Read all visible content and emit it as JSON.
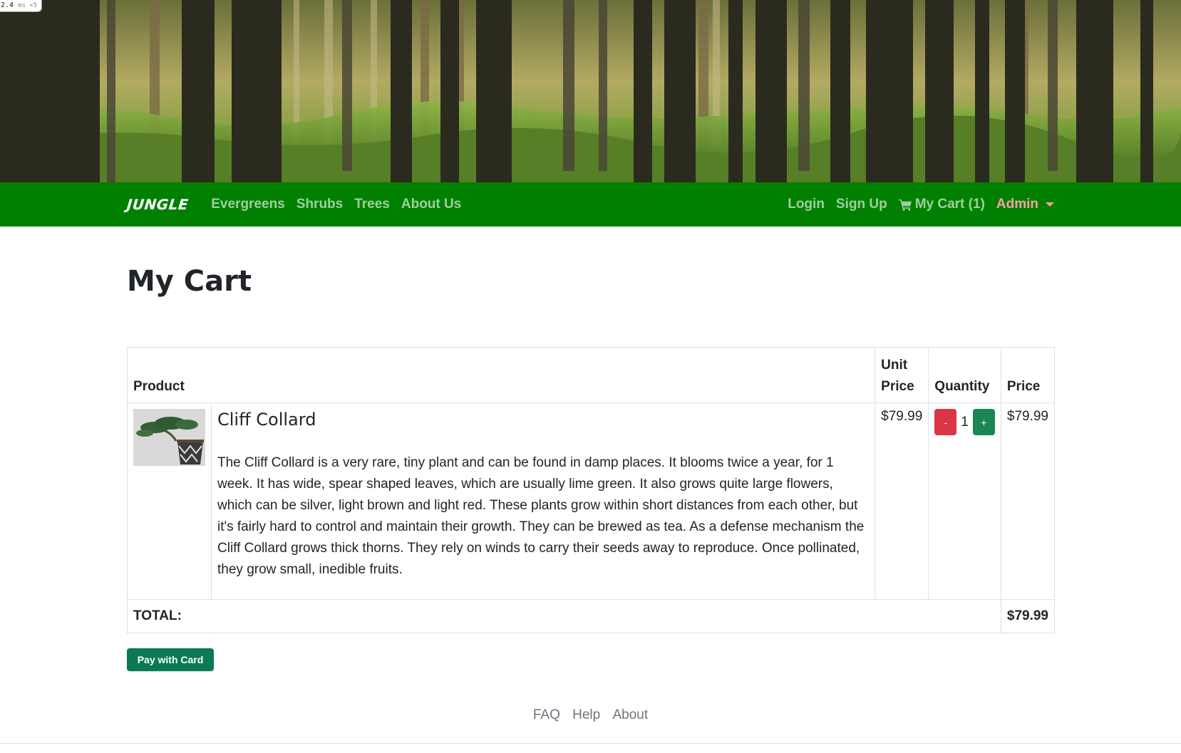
{
  "perf_badge": {
    "value": "2.4",
    "unit": "ms ×5"
  },
  "hero": {
    "image": "forest-banner"
  },
  "navbar": {
    "brand": "JUNGLE",
    "links": [
      "Evergreens",
      "Shrubs",
      "Trees",
      "About Us"
    ],
    "login": "Login",
    "signup": "Sign Up",
    "cart": "My Cart (1)",
    "admin": "Admin",
    "colors": {
      "background": "#008000",
      "admin": "#f4a3a3"
    }
  },
  "page": {
    "title": "My Cart"
  },
  "table": {
    "headers": {
      "product": "Product",
      "unit_price": "Unit Price",
      "quantity": "Quantity",
      "price": "Price"
    },
    "items": [
      {
        "name": "Cliff Collard",
        "image": "bonsai-pot-thumbnail",
        "description": "The Cliff Collard is a very rare, tiny plant and can be found in damp places. It blooms twice a year, for 1 week. It has wide, spear shaped leaves, which are usually lime green. It also grows quite large flowers, which can be silver, light brown and light red. These plants grow within short distances from each other, but it's fairly hard to control and maintain their growth. They can be brewed as tea. As a defense mechanism the Cliff Collard grows thick thorns. They rely on winds to carry their seeds away to reproduce. Once pollinated, they grow small, inedible fruits.",
        "unit_price": "$79.99",
        "decrement": "-",
        "quantity": "1",
        "increment": "+",
        "price": "$79.99"
      }
    ],
    "total_label": "TOTAL:",
    "total_value": "$79.99"
  },
  "actions": {
    "pay": "Pay with Card"
  },
  "footer": {
    "links": [
      "FAQ",
      "Help",
      "About"
    ]
  }
}
